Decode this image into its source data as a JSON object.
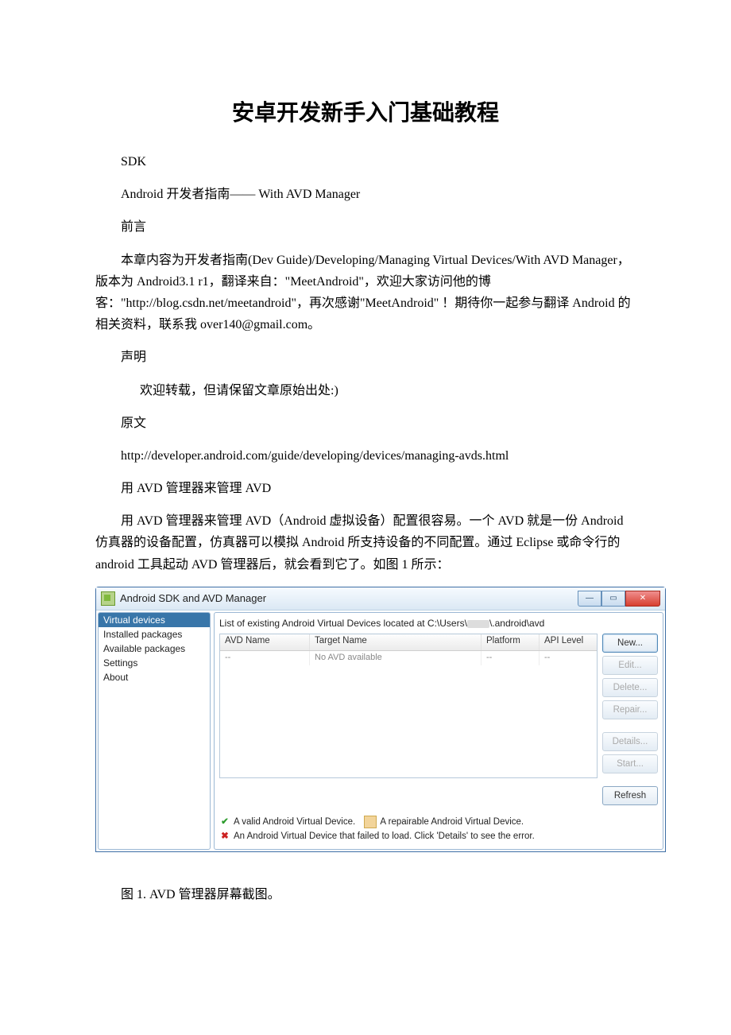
{
  "doc": {
    "title": "安卓开发新手入门基础教程",
    "sdk": "SDK",
    "subtitle": "Android 开发者指南—— With AVD Manager",
    "preface_h": "前言",
    "preface": "　　本章内容为开发者指南(Dev Guide)/Developing/Managing Virtual Devices/With AVD Manager，版本为 Android3.1 r1，翻译来自：\"MeetAndroid\"，欢迎大家访问他的博客：\"http://blog.csdn.net/meetandroid\"，再次感谢\"MeetAndroid\" ！期待你一起参与翻译 Android 的相关资料，联系我 over140@gmail.com。",
    "decl_h": "声明",
    "decl": "欢迎转载，但请保留文章原始出处:)",
    "orig_h": "原文",
    "orig_url": "http://developer.android.com/guide/developing/devices/managing-avds.html",
    "manage_h": "用 AVD 管理器来管理 AVD",
    "manage_body": "用 AVD 管理器来管理 AVD（Android 虚拟设备）配置很容易。一个 AVD 就是一份 Android 仿真器的设备配置，仿真器可以模拟 Android 所支持设备的不同配置。通过 Eclipse 或命令行的 android 工具起动 AVD 管理器后，就会看到它了。如图 1 所示：",
    "figure_caption": "图 1. AVD 管理器屏幕截图。"
  },
  "win": {
    "title": "Android SDK and AVD Manager",
    "sidebar": {
      "items": [
        {
          "label": "Virtual devices",
          "selected": true
        },
        {
          "label": "Installed packages"
        },
        {
          "label": "Available packages"
        },
        {
          "label": "Settings"
        },
        {
          "label": "About"
        }
      ]
    },
    "list_caption_prefix": "List of existing Android Virtual Devices located at C:\\Users\\",
    "list_caption_suffix": "\\.android\\avd",
    "columns": {
      "name": "AVD Name",
      "target": "Target Name",
      "platform": "Platform",
      "api": "API Level"
    },
    "row": {
      "name": "--",
      "target": "No AVD available",
      "platform": "--",
      "api": "--"
    },
    "buttons": {
      "new": "New...",
      "edit": "Edit...",
      "delete": "Delete...",
      "repair": "Repair...",
      "details": "Details...",
      "start": "Start...",
      "refresh": "Refresh"
    },
    "legend": {
      "valid": "A valid Android Virtual Device.",
      "repair": "A repairable Android Virtual Device.",
      "fail": "An Android Virtual Device that failed to load. Click 'Details' to see the error."
    }
  }
}
